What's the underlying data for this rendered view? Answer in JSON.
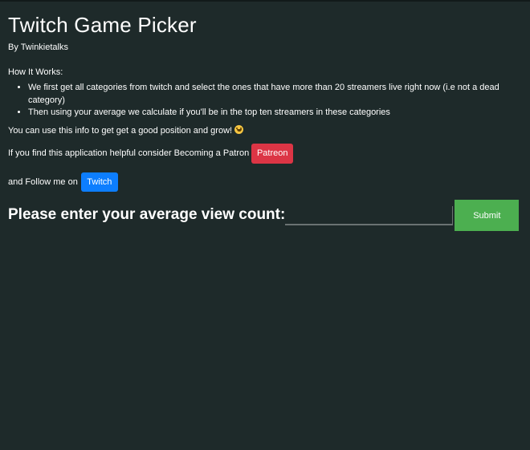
{
  "header": {
    "title": "Twitch Game Picker",
    "byline": "By Twinkietalks"
  },
  "info": {
    "how_heading": "How It Works:",
    "steps": [
      "We first get all categories from twitch and select the ones that have more than 20 streamers live right now (i.e not a dead category)",
      "Then using your average we calculate if you'll be in the top ten streamers in these categories"
    ],
    "tagline": "You can use this info to get get a good position and grow!",
    "emoji": "grinning-face-icon"
  },
  "patron": {
    "text": "If you find this application helpful consider Becoming a Patron",
    "button_label": "Patreon",
    "button_color": "#dc3545"
  },
  "follow": {
    "text": "and Follow me on",
    "button_label": "Twitch",
    "button_color": "#0d7eff"
  },
  "form": {
    "label": "Please enter your average view count:",
    "input_value": "",
    "submit_label": "Submit",
    "submit_color": "#4caf50"
  },
  "colors": {
    "background": "#1e2a2a",
    "text": "#ffffff"
  }
}
